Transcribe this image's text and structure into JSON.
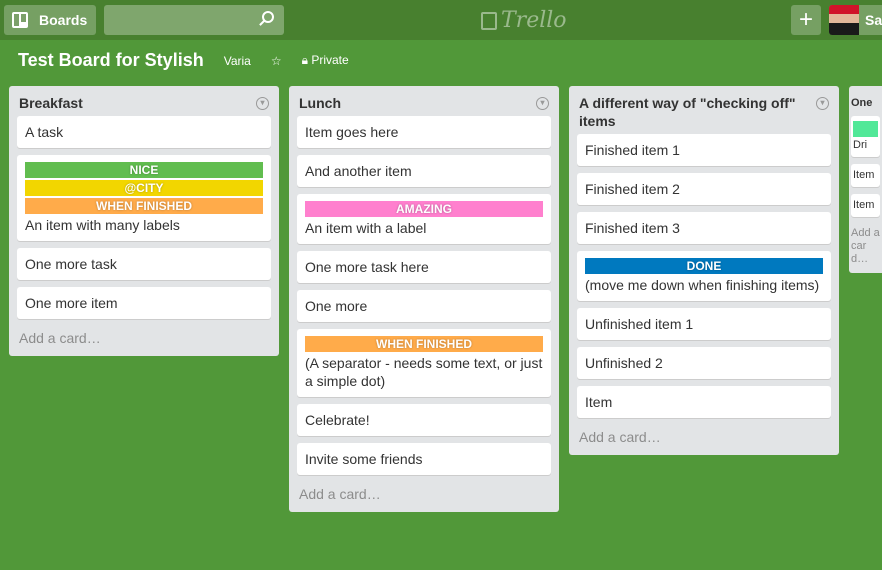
{
  "header": {
    "boards_label": "Boards",
    "search_placeholder": "",
    "logo_text": "Trello",
    "user_name": "Sa",
    "add_label": "+"
  },
  "board": {
    "title": "Test Board for Stylish",
    "org": "Varia",
    "visibility": "Private"
  },
  "add_card_label": "Add a card…",
  "colors": {
    "green": "#61bd4f",
    "yellow": "#f2d600",
    "orange": "#ffab4a",
    "pink": "#ff80ce",
    "blue": "#0079bf",
    "lime": "#51e898"
  },
  "lists": [
    {
      "title": "Breakfast",
      "cards": [
        {
          "text": "A task"
        },
        {
          "labels": [
            {
              "text": "NICE",
              "color": "#61bd4f"
            },
            {
              "text": "@CITY",
              "color": "#f2d600"
            },
            {
              "text": "WHEN FINISHED",
              "color": "#ffab4a"
            }
          ],
          "text": "An item with many labels"
        },
        {
          "text": "One more task"
        },
        {
          "text": "One more item"
        }
      ]
    },
    {
      "title": "Lunch",
      "cards": [
        {
          "text": "Item goes here"
        },
        {
          "text": "And another item"
        },
        {
          "labels": [
            {
              "text": "AMAZING",
              "color": "#ff80ce"
            }
          ],
          "text": "An item with a label"
        },
        {
          "text": "One more task here"
        },
        {
          "text": "One more"
        },
        {
          "labels": [
            {
              "text": "WHEN FINISHED",
              "color": "#ffab4a"
            }
          ],
          "text": "(A separator - needs some text, or just a simple dot)"
        },
        {
          "text": "Celebrate!"
        },
        {
          "text": "Invite some friends"
        }
      ]
    },
    {
      "title": "A different way of \"checking off\" items",
      "cards": [
        {
          "text": "Finished item 1"
        },
        {
          "text": "Finished item 2"
        },
        {
          "text": "Finished item 3"
        },
        {
          "labels": [
            {
              "text": "DONE",
              "color": "#0079bf"
            }
          ],
          "text": "(move me down when finishing items)"
        },
        {
          "text": "Unfinished item 1"
        },
        {
          "text": "Unfinished 2"
        },
        {
          "text": "Item"
        }
      ]
    },
    {
      "title": "One",
      "cards": [
        {
          "labels": [
            {
              "text": "",
              "color": "#51e898"
            }
          ],
          "text": "Dri"
        },
        {
          "text": "Item"
        },
        {
          "text": "Item"
        }
      ]
    }
  ]
}
